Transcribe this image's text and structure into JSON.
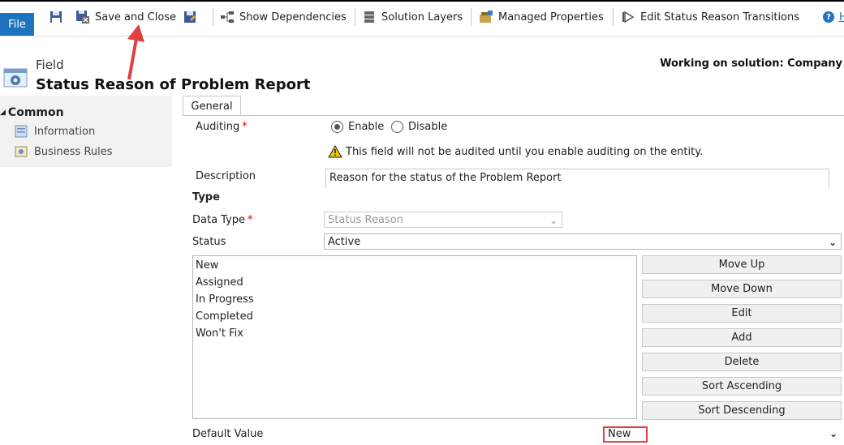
{
  "toolbar": {
    "file": "File",
    "save_close": "Save and Close",
    "show_dependencies": "Show Dependencies",
    "solution_layers": "Solution Layers",
    "managed_properties": "Managed Properties",
    "edit_transitions": "Edit Status Reason Transitions",
    "help_partial": "H"
  },
  "header": {
    "entity_type": "Field",
    "title": "Status Reason of Problem Report",
    "solution": "Working on solution: Company"
  },
  "nav": {
    "section": "Common",
    "items": [
      {
        "label": "Information",
        "icon": "information-icon"
      },
      {
        "label": "Business Rules",
        "icon": "business-rules-icon"
      }
    ]
  },
  "tab": {
    "label": "General"
  },
  "form": {
    "auditing_label": "Auditing",
    "auditing_options": [
      "Enable",
      "Disable"
    ],
    "auditing_selected": "Enable",
    "audit_warning": "This field will not be audited until you enable auditing on the entity.",
    "description_label": "Description",
    "description_value": "Reason for the status of the Problem Report",
    "type_heading": "Type",
    "data_type_label": "Data Type",
    "data_type_value": "Status Reason",
    "status_label": "Status",
    "status_value": "Active",
    "options": [
      "New",
      "Assigned",
      "In Progress",
      "Completed",
      "Won't Fix"
    ],
    "buttons": [
      "Move Up",
      "Move Down",
      "Edit",
      "Add",
      "Delete",
      "Sort Ascending",
      "Sort Descending"
    ],
    "default_label": "Default Value",
    "default_value": "New"
  },
  "colors": {
    "accent": "#1e73be",
    "annotation": "#e04040"
  }
}
